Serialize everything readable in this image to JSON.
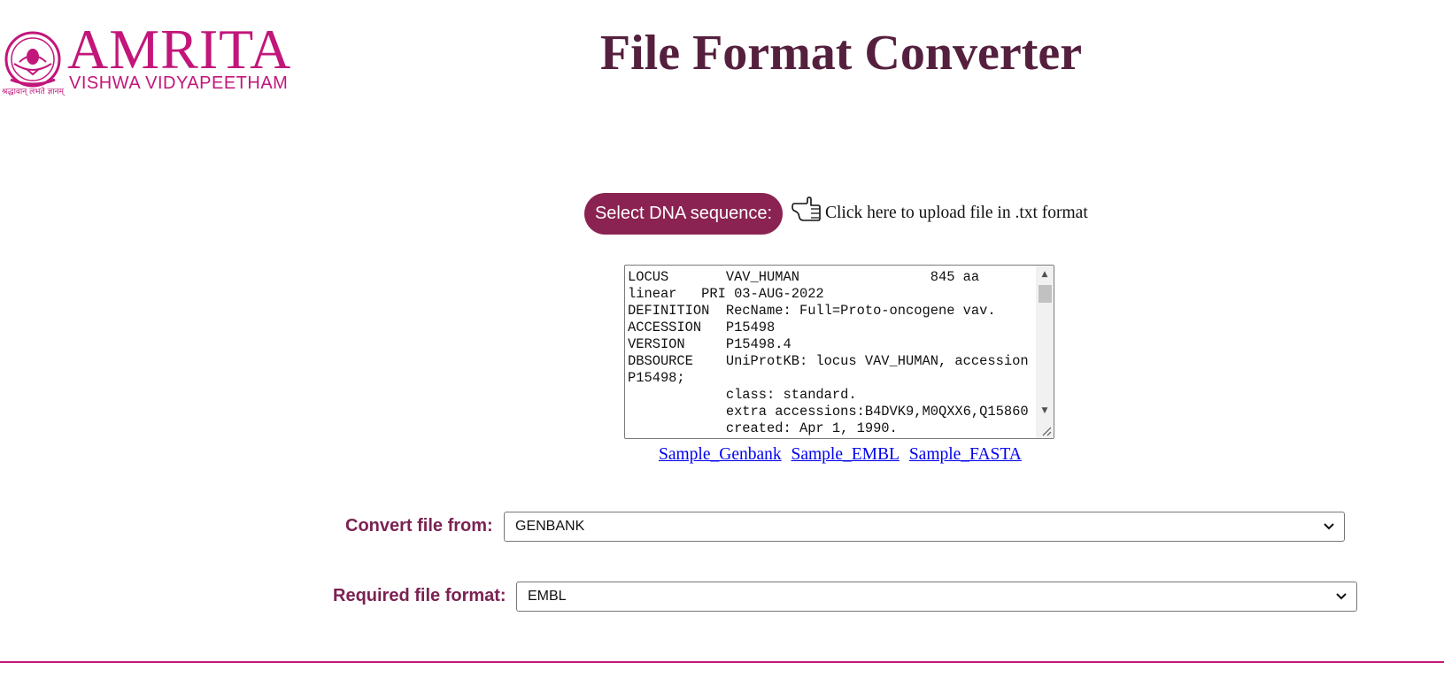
{
  "logo": {
    "name": "AMRITA",
    "subtitle": "VISHWA VIDYAPEETHAM",
    "motto": "श्रद्धावान् लभते ज्ञानम्"
  },
  "page": {
    "title": "File Format Converter"
  },
  "upload": {
    "button_label": "Select DNA sequence:",
    "hint": "Click here to upload file in .txt format",
    "icon": "pointing-hand-icon"
  },
  "sequence_input": {
    "value": "LOCUS       VAV_HUMAN                845 aa\nlinear   PRI 03-AUG-2022\nDEFINITION  RecName: Full=Proto-oncogene vav.\nACCESSION   P15498\nVERSION     P15498.4\nDBSOURCE    UniProtKB: locus VAV_HUMAN, accession\nP15498;\n            class: standard.\n            extra accessions:B4DVK9,M0QXX6,Q15860\n            created: Apr 1, 1990."
  },
  "samples": {
    "links": [
      "Sample_Genbank",
      "Sample_EMBL",
      "Sample_FASTA"
    ]
  },
  "convert_from": {
    "label": "Convert file from:",
    "value": "GENBANK"
  },
  "required_format": {
    "label": "Required file format:",
    "value": "EMBL"
  },
  "colors": {
    "brand": "#c2167a",
    "title": "#55203e",
    "button": "#8a2352",
    "label": "#7a2252",
    "link": "#0000ee"
  }
}
